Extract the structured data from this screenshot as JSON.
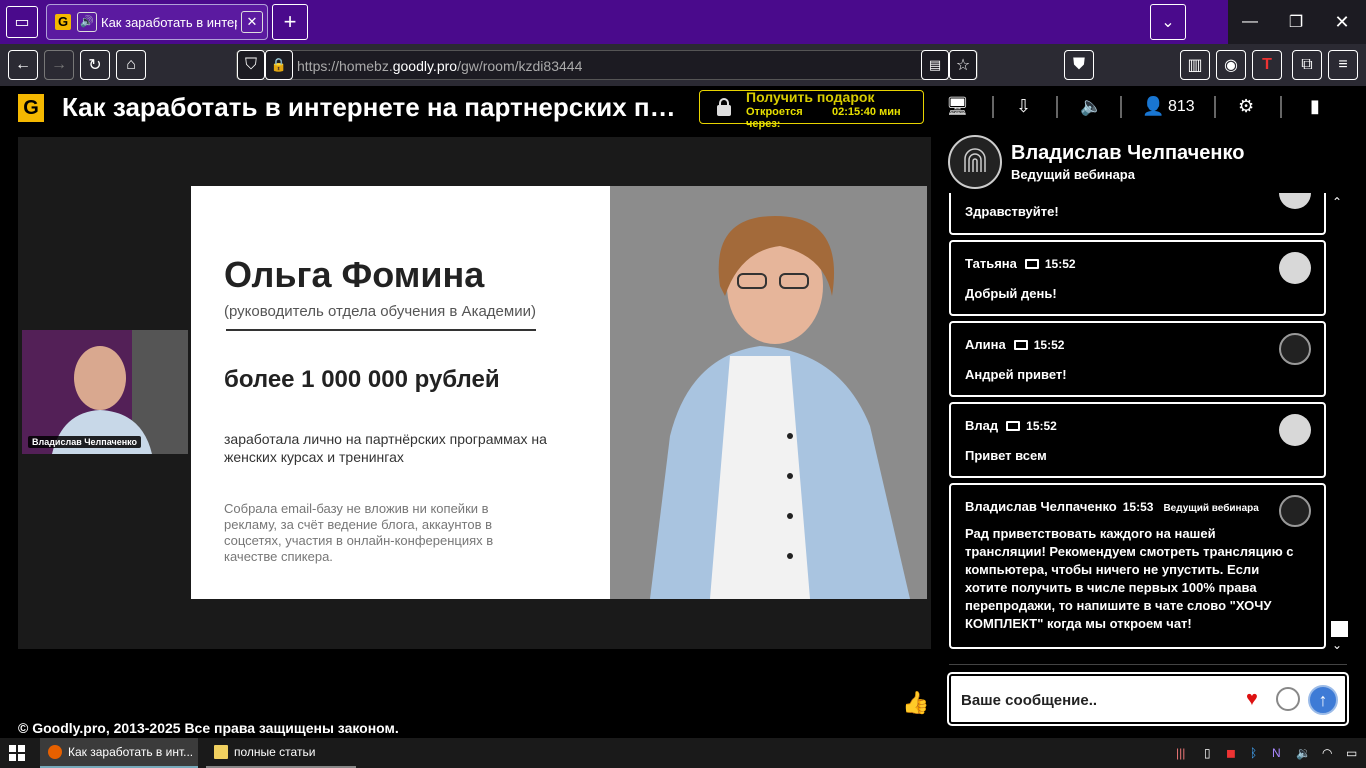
{
  "browser": {
    "tab": {
      "title": "Как заработать в интерне"
    },
    "new_tab_label": "+",
    "url_prefix": "https://homebz.",
    "url_domain": "goodly.pro",
    "url_path": "/gw/room/kzdi83444"
  },
  "header": {
    "logo": "G",
    "title": "Как заработать в интернете на партнерских прог...",
    "gift": {
      "title": "Получить подарок",
      "opens_label": "Откроется через:",
      "countdown": "02:15:40 мин"
    },
    "viewers": "813"
  },
  "video": {
    "slide": {
      "name": "Ольга Фомина",
      "role": "(руководитель отдела обучения в Академии)",
      "amount": "более 1 000 000 рублей",
      "earned": "заработала лично на партнёрских программах на женских курсах и тренингах",
      "details": "Собрала email-базу не вложив ни копейки в рекламу, за счёт ведение блога, аккаунтов в соцсетях, участия в онлайн-конференциях в качестве спикера."
    },
    "webcam_label": "Владислав Челпаченко"
  },
  "host": {
    "name": "Владислав Челпаченко",
    "role": "Ведущий вебинара"
  },
  "chat": {
    "messages": [
      {
        "author": "",
        "time": "",
        "text": "Здравствуйте!"
      },
      {
        "author": "Татьяна",
        "time": "15:52",
        "text": "Добрый день!"
      },
      {
        "author": "Алина",
        "time": "15:52",
        "text": "Андрей привет!"
      },
      {
        "author": "Влад",
        "time": "15:52",
        "text": "Привет всем"
      },
      {
        "author": "Владислав Челпаченко",
        "time": "15:53",
        "badge": "Ведущий вебинара",
        "text": "Рад приветствовать каждого на нашей трансляции! Рекомендуем смотреть трансляцию с компьютера, чтобы ничего не упустить. Если хотите получить в числе первых 100% права перепродажи, то напишите в чате слово \"ХОЧУ КОМПЛЕКТ\" когда мы откроем чат!"
      }
    ],
    "input_placeholder": "Ваше сообщение.."
  },
  "footer": {
    "copyright": "© Goodly.pro, 2013-2025 Все права защищены законом."
  },
  "taskbar": {
    "items": [
      "Как заработать в инт...",
      "полные статьи"
    ]
  },
  "colors": {
    "brand": "#f5b800",
    "tabstrip": "#4a0a8c",
    "gift_border": "#e8d400",
    "send": "#3e7bd6"
  }
}
